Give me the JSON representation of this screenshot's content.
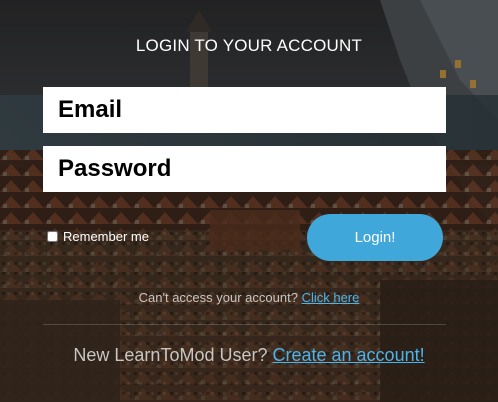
{
  "login": {
    "title": "LOGIN TO YOUR ACCOUNT",
    "email_placeholder": "Email",
    "password_placeholder": "Password",
    "remember_label": "Remember me",
    "remember_checked": false,
    "login_button": "Login!",
    "help_text": "Can't access your account?",
    "help_link": "Click here",
    "new_user_text": "New LearnToMod User?",
    "create_link": "Create an account!"
  },
  "colors": {
    "accent": "#3fa7da",
    "link": "#4bb4ea",
    "text": "#ffffff"
  }
}
